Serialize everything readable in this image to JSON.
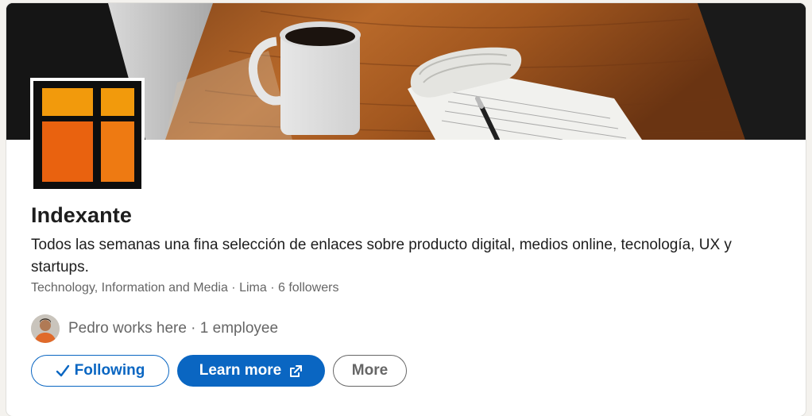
{
  "company": {
    "name": "Indexante",
    "tagline": "Todos las semanas una fina selección de enlaces sobre producto digital, medios online, tecnología, UX y startups.",
    "meta": "Technology, Information and Media · Lima · 6 followers",
    "employees_text": "Pedro works here · 1 employee"
  },
  "actions": {
    "following_label": "Following",
    "learn_more_label": "Learn more",
    "more_label": "More"
  },
  "icons": {
    "following": "checkmark-icon",
    "learn_more": "external-link-icon",
    "avatar": "avatar"
  },
  "colors": {
    "primary_blue": "#0a66c2",
    "text_primary": "#1d1d1d",
    "text_secondary": "#666666",
    "logo_orange_light": "#f29a0c",
    "logo_orange_dark": "#e9620f"
  }
}
